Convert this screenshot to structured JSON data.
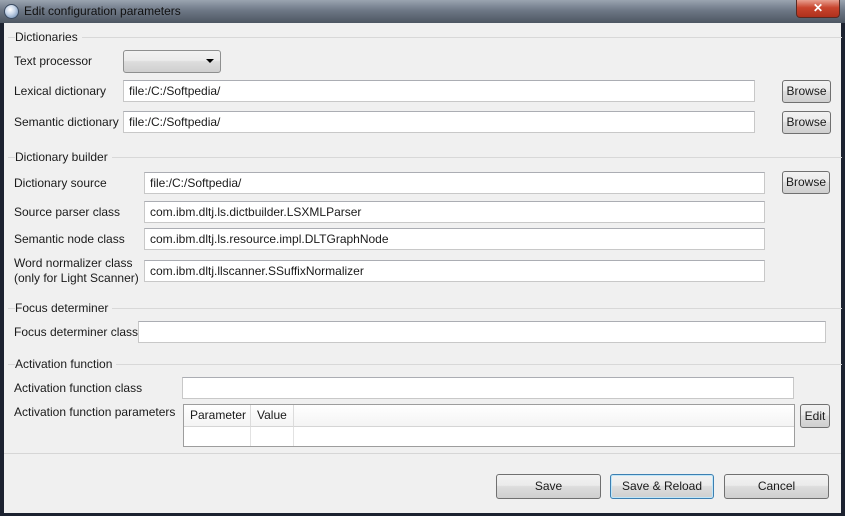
{
  "window": {
    "title": "Edit configuration parameters",
    "close_glyph": "✕",
    "app_icon": "app-globe-icon"
  },
  "dictionaries": {
    "caption": "Dictionaries",
    "text_processor_label": "Text processor",
    "text_processor_value": "",
    "lexical_label": "Lexical dictionary",
    "lexical_value": "file:/C:/Softpedia/",
    "semantic_label": "Semantic dictionary",
    "semantic_value": "file:/C:/Softpedia/",
    "browse_label": "Browse"
  },
  "builder": {
    "caption": "Dictionary builder",
    "source_label": "Dictionary source",
    "source_value": "file:/C:/Softpedia/",
    "parser_label": "Source parser class",
    "parser_value": "com.ibm.dltj.ls.dictbuilder.LSXMLParser",
    "node_label": "Semantic node class",
    "node_value": "com.ibm.dltj.ls.resource.impl.DLTGraphNode",
    "normalizer_label_1": "Word normalizer class",
    "normalizer_label_2": "(only for Light Scanner)",
    "normalizer_value": "com.ibm.dltj.llscanner.SSuffixNormalizer",
    "browse_label": "Browse"
  },
  "focus": {
    "caption": "Focus determiner",
    "class_label": "Focus determiner class",
    "class_value": ""
  },
  "activation": {
    "caption": "Activation function",
    "class_label": "Activation function class",
    "class_value": "",
    "params_label": "Activation function parameters",
    "table_headers": [
      "Parameter",
      "Value"
    ],
    "edit_label": "Edit"
  },
  "footer": {
    "save_label": "Save",
    "save_reload_label": "Save & Reload",
    "cancel_label": "Cancel"
  }
}
